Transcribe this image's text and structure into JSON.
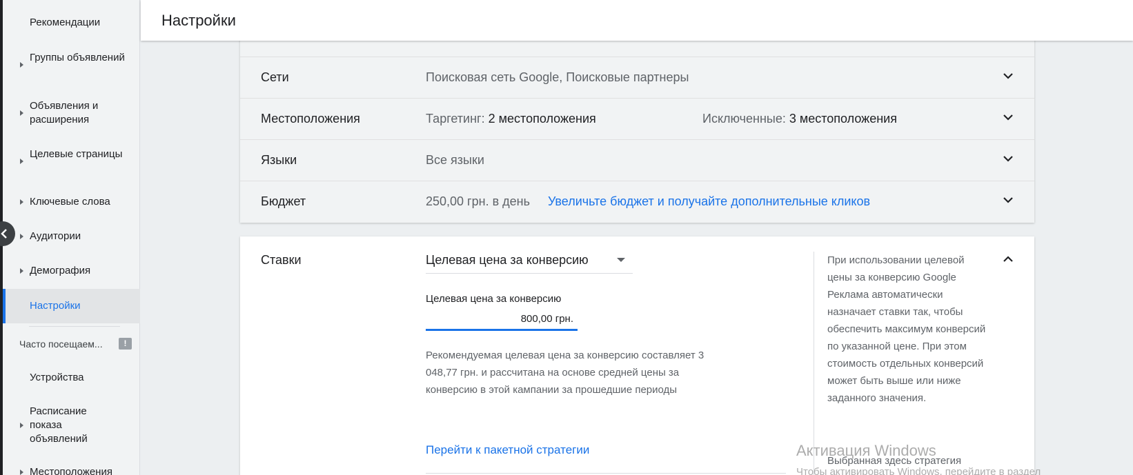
{
  "sidebar": {
    "items": [
      {
        "label": "Рекомендации"
      },
      {
        "label": "Группы объявлений"
      },
      {
        "label": "Объявления и расширения"
      },
      {
        "label": "Целевые страницы"
      },
      {
        "label": "Ключевые слова"
      },
      {
        "label": "Аудитории"
      },
      {
        "label": "Демография"
      },
      {
        "label": "Настройки"
      },
      {
        "label": "Устройства"
      },
      {
        "label": "Расписание показа объявлений"
      },
      {
        "label": "Местоположения"
      }
    ],
    "frequent_label": "Часто посещаем...",
    "frequent_icon": "feedback-icon"
  },
  "header": {
    "title": "Настройки"
  },
  "settings": {
    "networks": {
      "name": "Сети",
      "value": "Поисковая сеть Google, Поисковые партнеры"
    },
    "locations": {
      "name": "Местоположения",
      "targeting_label": "Таргетинг:",
      "targeting_value": "2 местоположения",
      "excluded_label": "Исключенные:",
      "excluded_value": "3 местоположения"
    },
    "languages": {
      "name": "Языки",
      "value": "Все языки"
    },
    "budget": {
      "name": "Бюджет",
      "value": "250,00 грн. в день",
      "link": "Увеличьте бюджет и получайте дополнительные кликов"
    }
  },
  "bids": {
    "name": "Ставки",
    "strategy": "Целевая цена за конверсию",
    "field_label": "Целевая цена за конверсию",
    "field_value": "800,00 грн.",
    "recommendation": "Рекомендуемая целевая цена за конверсию составляет 3 048,77 грн. и рассчитана на основе средней цены за конверсию в этой кампании за прошедшие периоды",
    "package_link": "Перейти к пакетной стратегии",
    "help": "При использовании целевой цены за конверсию Google Реклама автоматически назначает ставки так, чтобы обеспечить максимум конверсий по указанной цене. При этом стоимость отдельных конверсий может быть выше или ниже заданного значения.",
    "help_more": "Выбранная здесь стратегия"
  },
  "watermark": {
    "title": "Активация Windows",
    "subtitle": "Чтобы активировать Windows, перейдите в раздел"
  },
  "colors": {
    "accent": "#1a73e8",
    "sidebar_bg": "#f1f3f4",
    "active_bg": "#e2e4e6"
  }
}
